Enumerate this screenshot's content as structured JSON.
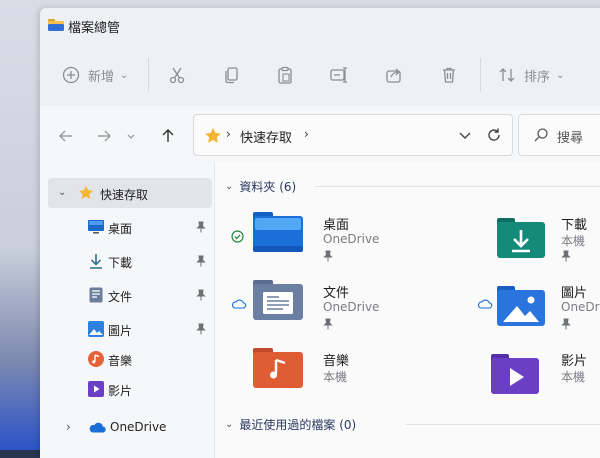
{
  "window": {
    "title": "檔案總管"
  },
  "toolbar": {
    "new_label": "新增",
    "sort_label": "排序"
  },
  "address": {
    "path": "快速存取"
  },
  "search": {
    "placeholder": "搜尋"
  },
  "sidebar": {
    "quick_access": "快速存取",
    "items": [
      {
        "label": "桌面",
        "icon": "desktop-icon",
        "pinned": true
      },
      {
        "label": "下載",
        "icon": "download-icon",
        "pinned": true
      },
      {
        "label": "文件",
        "icon": "document-icon",
        "pinned": true
      },
      {
        "label": "圖片",
        "icon": "pictures-icon",
        "pinned": true
      },
      {
        "label": "音樂",
        "icon": "music-icon",
        "pinned": false
      },
      {
        "label": "影片",
        "icon": "video-icon",
        "pinned": false
      }
    ],
    "onedrive": "OneDrive"
  },
  "main": {
    "folders_header": "資料夾 (6)",
    "recent_header": "最近使用過的檔案 (0)",
    "folders": [
      {
        "name": "桌面",
        "location": "OneDrive",
        "status": "synced"
      },
      {
        "name": "下載",
        "location": "本機",
        "status": ""
      },
      {
        "name": "文件",
        "location": "OneDrive",
        "status": "cloud"
      },
      {
        "name": "圖片",
        "location": "OneDrive",
        "status": "cloud"
      },
      {
        "name": "音樂",
        "location": "本機",
        "status": ""
      },
      {
        "name": "影片",
        "location": "本機",
        "status": ""
      }
    ]
  },
  "colors": {
    "accent": "#1a73d9",
    "folder": "#f2c14e",
    "selection": "#e2e4e8"
  }
}
